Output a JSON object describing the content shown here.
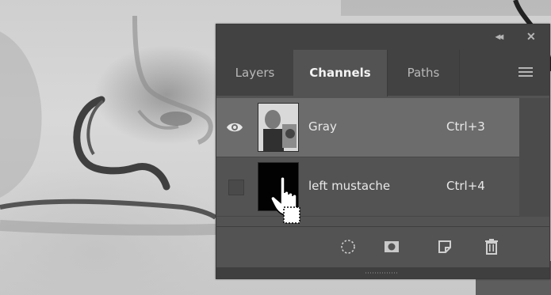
{
  "panel": {
    "tabs": [
      {
        "label": "Layers",
        "active": false
      },
      {
        "label": "Channels",
        "active": true
      },
      {
        "label": "Paths",
        "active": false
      }
    ],
    "channels": [
      {
        "name": "Gray",
        "shortcut": "Ctrl+3",
        "visible": true,
        "selected": true
      },
      {
        "name": "left mustache",
        "shortcut": "Ctrl+4",
        "visible": false,
        "selected": false
      }
    ],
    "bottom_icons": [
      "load-selection-icon",
      "save-selection-icon",
      "new-channel-icon",
      "delete-channel-icon"
    ],
    "colors": {
      "panel_bg": "#535353",
      "selected_row": "#6c6c6c",
      "tab_strip": "#424242"
    }
  }
}
